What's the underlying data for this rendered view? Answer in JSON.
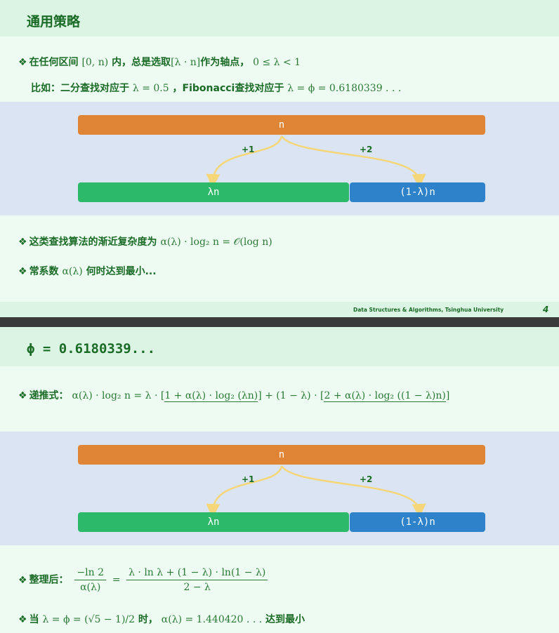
{
  "slide1": {
    "title": "通用策略",
    "b1_text": "在任何区间",
    "b1_interval": "[0, n)",
    "b1_text2": "内，总是选取",
    "b1_pivot": "[λ · n]",
    "b1_text3": "作为轴点，",
    "b1_range": "0 ≤ λ < 1",
    "example_text": "比如：二分查找对应于",
    "example_math1": "λ = 0.5",
    "example_text2": "，Fibonacci查找对应于",
    "example_math2": "λ = ϕ = 0.6180339 . . .",
    "b2_text": "这类查找算法的渐近复杂度为",
    "b2_math": "α(λ) · log₂ n  =  𝒪(log n)",
    "b3_text": "常系数",
    "b3_math": "α(λ)",
    "b3_text2": "何时达到最小...",
    "footer": "Data Structures & Algorithms, Tsinghua University",
    "page": "4"
  },
  "diagram": {
    "top_label": "n",
    "left_inc": "+1",
    "right_inc": "+2",
    "left_label": "λn",
    "right_label": "(1-λ)n"
  },
  "slide2": {
    "title": "ϕ = 0.6180339...",
    "recur_label": "递推式：",
    "recur_lhs": "α(λ) · log₂ n   =   λ · ",
    "recur_t1": "1 + α(λ) · log₂ (λn)",
    "recur_mid": "   +   (1 − λ) · ",
    "recur_t2": "2 + α(λ) · log₂ ((1 − λ)n)",
    "simplify_label": "整理后：",
    "frac1_num": "−ln 2",
    "frac1_den": "α(λ)",
    "frac2_num": "λ · ln λ + (1 − λ) · ln(1 − λ)",
    "frac2_den": "2 − λ",
    "when_label": "当",
    "when_math": "λ = ϕ = (√5 − 1)/2",
    "when_text": "时，",
    "when_math2": "α(λ) = 1.440420 . . .",
    "when_text2": "达到最小"
  },
  "colors": {
    "orange": "#e08536",
    "green": "#2cb96a",
    "blue": "#2e82c9",
    "arrow": "#f5d77a",
    "text": "#1a6b26"
  }
}
